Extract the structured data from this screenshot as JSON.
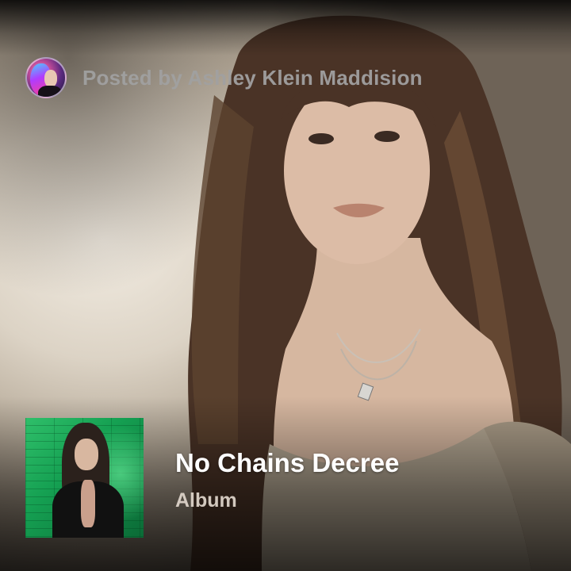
{
  "post": {
    "posted_by": "Posted by Ashley Klein Maddision",
    "author_avatar_icon": "user-avatar"
  },
  "album": {
    "title": "No Chains Decree",
    "type": "Album",
    "cover_icon": "album-cover-art"
  },
  "colors": {
    "title": "#ffffff",
    "posted_by": "#a0a0a0",
    "cover_accent": "#15a052"
  }
}
